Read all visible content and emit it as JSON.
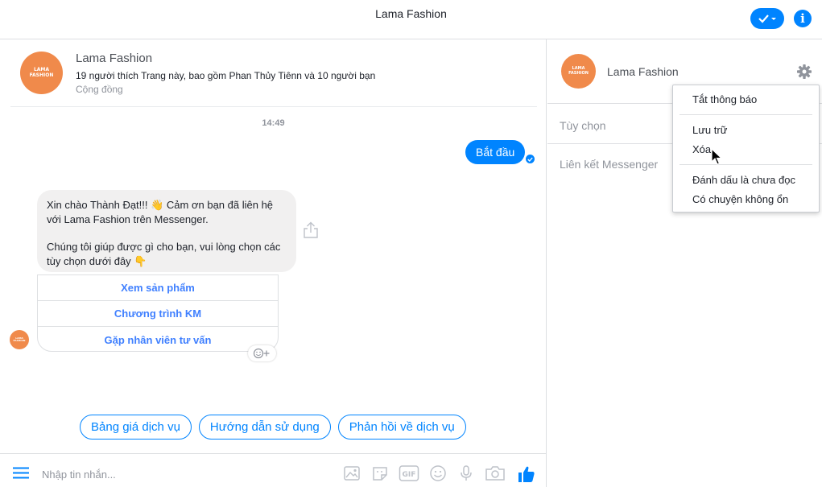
{
  "header": {
    "title": "Lama Fashion"
  },
  "page_card": {
    "logo_line1": "LAMA",
    "logo_line2": "FASHION",
    "name": "Lama Fashion",
    "likes": "19 người thích Trang này, bao gồm Phan Thủy Tiênn và 10 người bạn",
    "category": "Cộng đồng"
  },
  "conversation": {
    "timestamp": "14:49",
    "sent_message": "Bắt đầu",
    "received_paragraph1": "Xin chào Thành Đạt!!! 👋 Cảm ơn bạn đã liên hệ với Lama Fashion trên Messenger.",
    "received_paragraph2": "Chúng tôi giúp được gì cho bạn, vui lòng chọn các tùy chọn dưới đây 👇",
    "buttons": [
      "Xem sản phẩm",
      "Chương trình KM",
      "Gặp nhân viên tư vấn"
    ]
  },
  "quick_replies": [
    "Bảng giá dịch vụ",
    "Hướng dẫn sử dụng",
    "Phản hồi về dịch vụ"
  ],
  "composer": {
    "placeholder": "Nhập tin nhắn..."
  },
  "right_panel": {
    "name": "Lama Fashion",
    "options_label": "Tùy chọn",
    "link_label": "Liên kết Messenger"
  },
  "dropdown": {
    "items": [
      "Tắt thông báo",
      "Lưu trữ",
      "Xóa",
      "Đánh dấu là chưa đọc",
      "Có chuyện không ổn"
    ]
  },
  "colors": {
    "accent": "#0084ff",
    "link_blue": "#4080ff",
    "logo_orange": "#f08a4b",
    "bubble_gray": "#f1f0f0"
  }
}
